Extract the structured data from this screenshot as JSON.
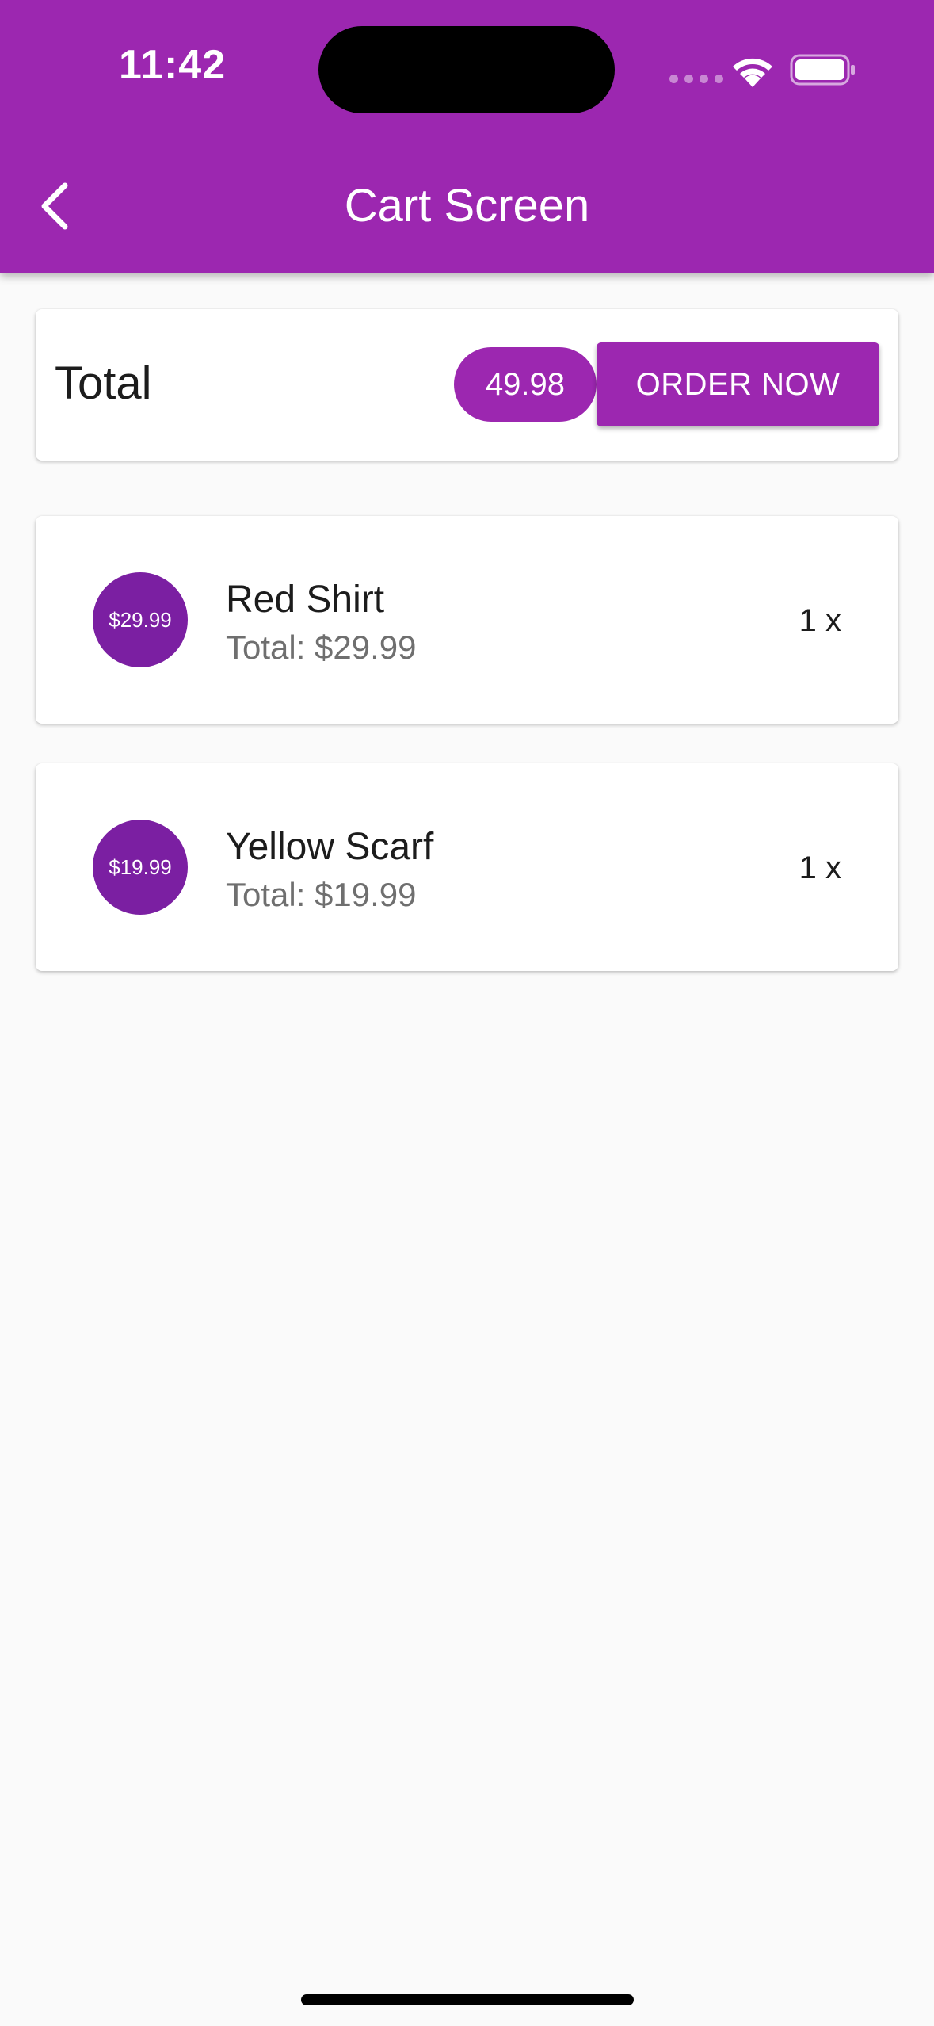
{
  "status_bar": {
    "time": "11:42",
    "icons": [
      "cellular-dots-icon",
      "wifi-icon",
      "battery-icon"
    ]
  },
  "app_bar": {
    "back_icon": "chevron-left-icon",
    "title": "Cart Screen",
    "color": "#9c27b0"
  },
  "summary": {
    "label": "Total",
    "amount": "49.98",
    "order_button": "ORDER NOW"
  },
  "cart_items": [
    {
      "price_badge": "$29.99",
      "title": "Red Shirt",
      "subtitle": "Total: $29.99",
      "quantity": "1 x"
    },
    {
      "price_badge": "$19.99",
      "title": "Yellow Scarf",
      "subtitle": "Total: $19.99",
      "quantity": "1 x"
    }
  ],
  "colors": {
    "primary": "#9c27b0",
    "avatar": "#7b1fa2",
    "background": "#fafafa"
  }
}
